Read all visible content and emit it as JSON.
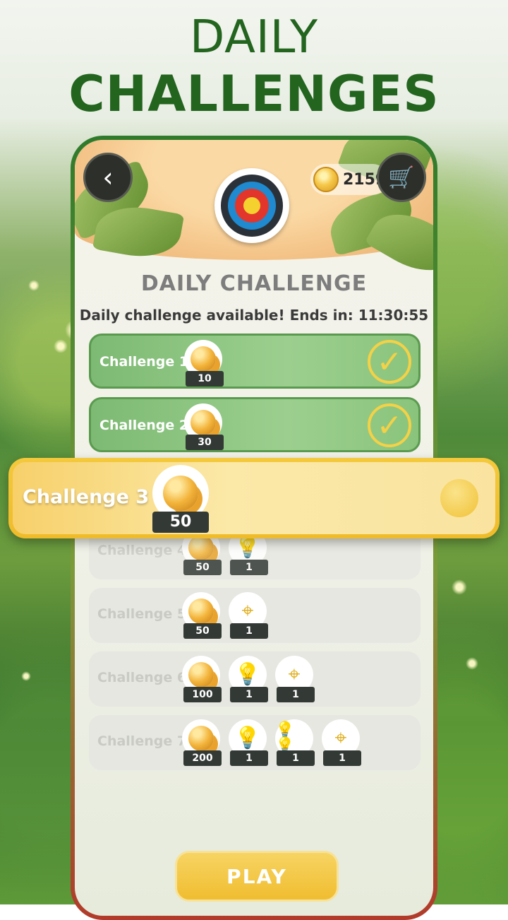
{
  "title_line1": "DAILY",
  "title_line2": "CHALLENGES",
  "header": {
    "back_icon": "back-arrow-icon",
    "coins": "2159",
    "cart_icon": "cart-icon"
  },
  "panel": {
    "title": "DAILY CHALLENGE",
    "subtitle": "Daily challenge available! Ends in: 11:30:55"
  },
  "challenges": [
    {
      "label": "Challenge 1",
      "status": "completed",
      "rewards": [
        {
          "type": "coins",
          "amount": "10"
        }
      ]
    },
    {
      "label": "Challenge 2",
      "status": "completed",
      "rewards": [
        {
          "type": "coins",
          "amount": "30"
        }
      ]
    },
    {
      "label": "Challenge 3",
      "status": "active",
      "rewards": [
        {
          "type": "coins",
          "amount": "50"
        }
      ]
    },
    {
      "label": "Challenge 4",
      "status": "locked",
      "rewards": [
        {
          "type": "coins",
          "amount": "50"
        },
        {
          "type": "hint",
          "amount": "1"
        }
      ]
    },
    {
      "label": "Challenge 5",
      "status": "locked",
      "rewards": [
        {
          "type": "coins",
          "amount": "50"
        },
        {
          "type": "target",
          "amount": "1"
        }
      ]
    },
    {
      "label": "Challenge 6",
      "status": "locked",
      "rewards": [
        {
          "type": "coins",
          "amount": "100"
        },
        {
          "type": "hint",
          "amount": "1"
        },
        {
          "type": "target",
          "amount": "1"
        }
      ]
    },
    {
      "label": "Challenge 7",
      "status": "locked",
      "rewards": [
        {
          "type": "coins",
          "amount": "200"
        },
        {
          "type": "hint",
          "amount": "1"
        },
        {
          "type": "multi-hint",
          "amount": "1"
        },
        {
          "type": "target",
          "amount": "1"
        }
      ]
    }
  ],
  "play_label": "PLAY",
  "colors": {
    "title_green": "#23641f",
    "done_green": "#8ac47c",
    "active_gold": "#f0bd30"
  }
}
